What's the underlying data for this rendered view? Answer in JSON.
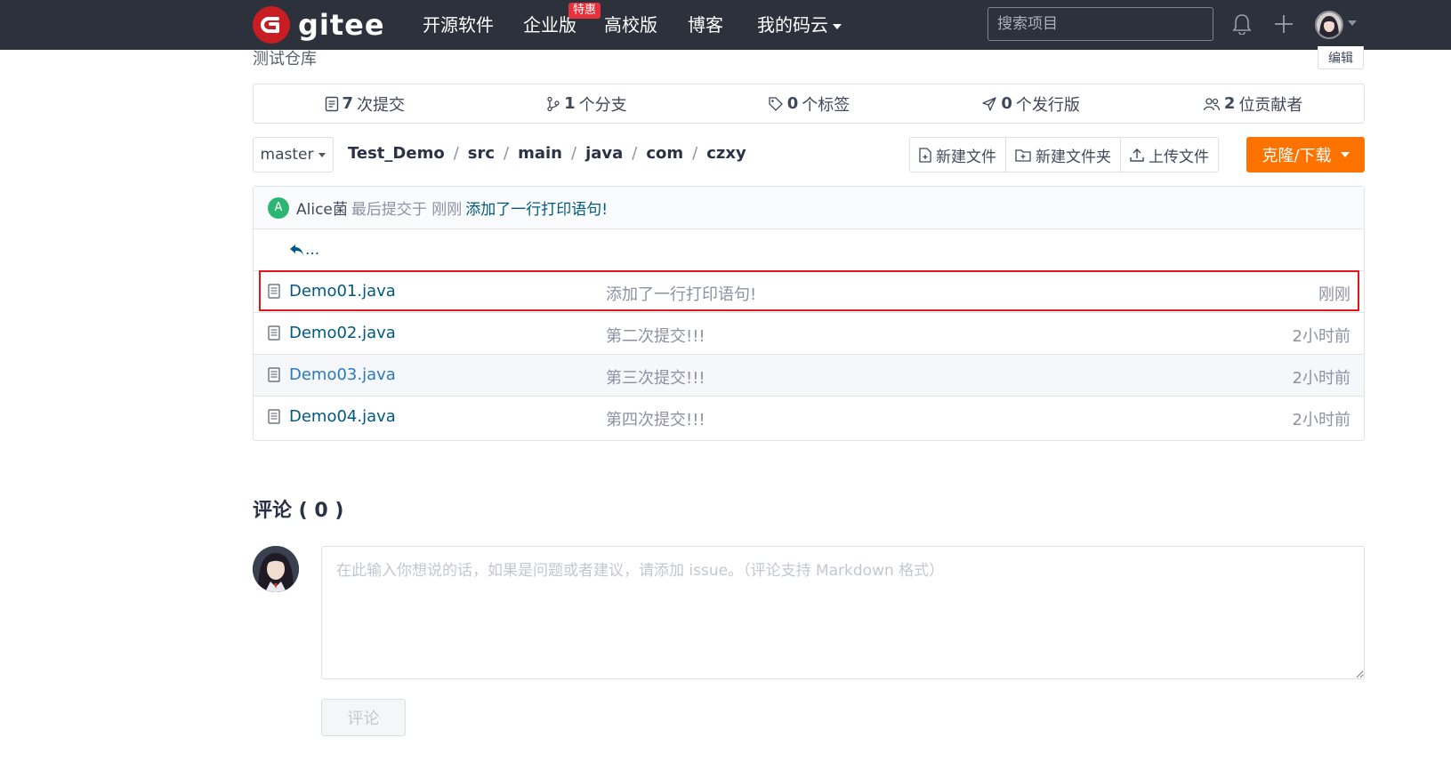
{
  "header": {
    "logo_text": "gitee",
    "nav": [
      {
        "label": "开源软件"
      },
      {
        "label": "企业版",
        "badge": "特惠"
      },
      {
        "label": "高校版"
      },
      {
        "label": "博客"
      },
      {
        "label": "我的码云"
      }
    ],
    "search_placeholder": "搜索项目",
    "icons": [
      "bell-icon",
      "plus-icon",
      "user-avatar"
    ]
  },
  "repo": {
    "description": "测试仓库",
    "edit_label": "编辑",
    "stats": [
      {
        "icon": "commit-icon",
        "count": "7",
        "label": "次提交"
      },
      {
        "icon": "branch-icon",
        "count": "1",
        "label": "个分支"
      },
      {
        "icon": "tag-icon",
        "count": "0",
        "label": "个标签"
      },
      {
        "icon": "release-icon",
        "count": "0",
        "label": "个发行版"
      },
      {
        "icon": "contributors-icon",
        "count": "2",
        "label": "位贡献者"
      }
    ]
  },
  "toolbar": {
    "branch": "master",
    "breadcrumb": [
      "Test_Demo",
      "src",
      "main",
      "java",
      "com",
      "czxy"
    ],
    "new_file": "新建文件",
    "new_folder": "新建文件夹",
    "upload": "上传文件",
    "clone": "克隆/下载"
  },
  "latest_commit": {
    "avatar_letter": "A",
    "author": "Alice菌",
    "meta": "最后提交于 刚刚",
    "message": "添加了一行打印语句!"
  },
  "back_link": "...",
  "files": [
    {
      "name": "Demo01.java",
      "message": "添加了一行打印语句!",
      "time": "刚刚",
      "highlighted": true
    },
    {
      "name": "Demo02.java",
      "message": "第二次提交!!!",
      "time": "2小时前"
    },
    {
      "name": "Demo03.java",
      "message": "第三次提交!!!",
      "time": "2小时前"
    },
    {
      "name": "Demo04.java",
      "message": "第四次提交!!!",
      "time": "2小时前"
    }
  ],
  "comments": {
    "title": "评论 ( 0 )",
    "placeholder": "在此输入你想说的话，如果是问题或者建议，请添加 issue。（评论支持 Markdown 格式）",
    "submit_label": "评论"
  },
  "colors": {
    "header_bg": "#2c313b",
    "accent_orange": "#fe7300",
    "link_blue": "#005980",
    "highlight_red": "#e4141b",
    "logo_red": "#c71d23"
  }
}
